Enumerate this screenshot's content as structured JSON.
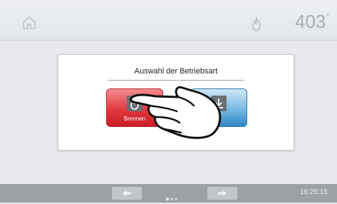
{
  "header": {
    "home_icon": "home-icon",
    "flame_icon": "flame-icon",
    "temperature": "403",
    "temperature_unit": "°"
  },
  "dialog": {
    "title": "Auswahl der Betriebsart",
    "options": [
      {
        "label": "Brennen",
        "icon": "flame-icon",
        "color": "#e0333b"
      },
      {
        "label": "",
        "icon": "download-arrow-icon",
        "color": "#2f86c4"
      }
    ]
  },
  "footer": {
    "prev_icon": "arrow-left-icon",
    "next_icon": "arrow-right-icon",
    "page_dots": 3,
    "active_dot": 1,
    "time": "16:25:15"
  }
}
